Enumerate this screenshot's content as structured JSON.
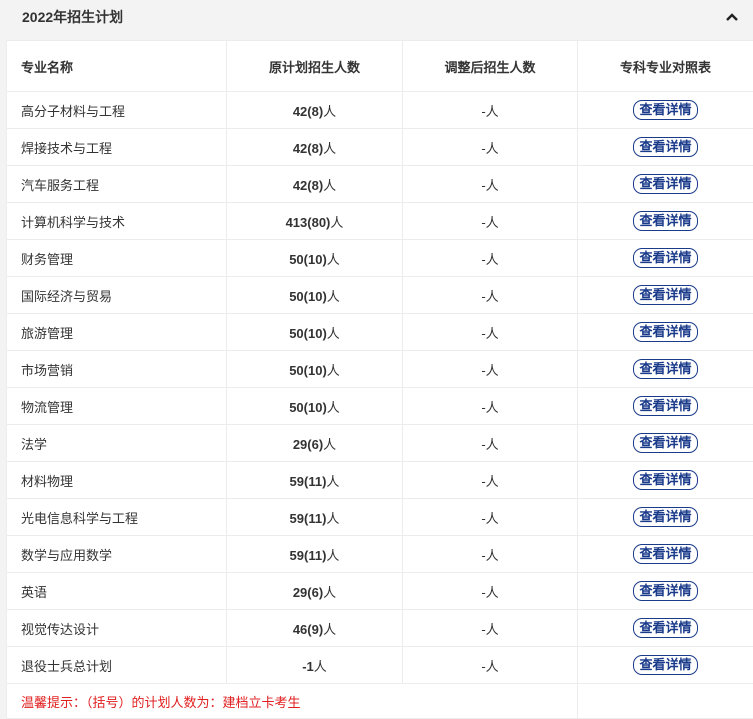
{
  "header": {
    "title": "2022年招生计划",
    "collapse_icon": "chevron-up-icon"
  },
  "table": {
    "columns": [
      "专业名称",
      "原计划招生人数",
      "调整后招生人数",
      "专科专业对照表"
    ],
    "unit": "人",
    "detail_label": "查看详情",
    "rows": [
      {
        "name": "高分子材料与工程",
        "plan": "42(8)",
        "adjusted": "-人"
      },
      {
        "name": "焊接技术与工程",
        "plan": "42(8)",
        "adjusted": "-人"
      },
      {
        "name": "汽车服务工程",
        "plan": "42(8)",
        "adjusted": "-人"
      },
      {
        "name": "计算机科学与技术",
        "plan": "413(80)",
        "adjusted": "-人"
      },
      {
        "name": "财务管理",
        "plan": "50(10)",
        "adjusted": "-人"
      },
      {
        "name": "国际经济与贸易",
        "plan": "50(10)",
        "adjusted": "-人"
      },
      {
        "name": "旅游管理",
        "plan": "50(10)",
        "adjusted": "-人"
      },
      {
        "name": "市场营销",
        "plan": "50(10)",
        "adjusted": "-人"
      },
      {
        "name": "物流管理",
        "plan": "50(10)",
        "adjusted": "-人"
      },
      {
        "name": "法学",
        "plan": "29(6)",
        "adjusted": "-人"
      },
      {
        "name": "材料物理",
        "plan": "59(11)",
        "adjusted": "-人"
      },
      {
        "name": "光电信息科学与工程",
        "plan": "59(11)",
        "adjusted": "-人"
      },
      {
        "name": "数学与应用数学",
        "plan": "59(11)",
        "adjusted": "-人"
      },
      {
        "name": "英语",
        "plan": "29(6)",
        "adjusted": "-人"
      },
      {
        "name": "视觉传达设计",
        "plan": "46(9)",
        "adjusted": "-人"
      },
      {
        "name": "退役士兵总计划",
        "plan": "-1",
        "adjusted": "-人"
      }
    ],
    "note": "温馨提示：（括号）的计划人数为：建档立卡考生"
  },
  "colors": {
    "note": "#e02020",
    "button": "#1a3a8a"
  }
}
